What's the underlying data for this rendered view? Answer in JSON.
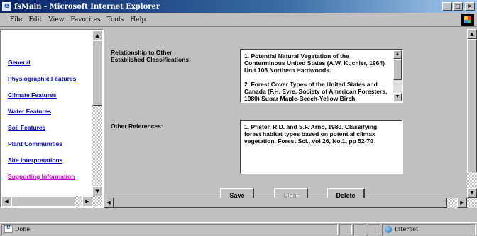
{
  "window": {
    "title": "fsMain - Microsoft Internet Explorer"
  },
  "menu": {
    "items": [
      "File",
      "Edit",
      "View",
      "Favorites",
      "Tools",
      "Help"
    ]
  },
  "nav": {
    "items": [
      {
        "label": "General"
      },
      {
        "label": "Physiographic Features"
      },
      {
        "label": "Climate Features"
      },
      {
        "label": "Water Features"
      },
      {
        "label": "Soil Features"
      },
      {
        "label": "Plant Communities"
      },
      {
        "label": "Site Interpretations"
      },
      {
        "label": "Supporting Information"
      }
    ],
    "active_color": "#cc00cc",
    "link_color": "#0000cc"
  },
  "form": {
    "relationship": {
      "label_line1": "Relationship to Other",
      "label_line2": "Established Classifications:",
      "para1": "1. Potential Natural Vegetation of the Conterminous United States (A.W. Kuchler, 1964) Unit 106 Northern Hardwoods.",
      "para2": "2. Forest Cover Types of the United States and Canada (F.H. Eyre, Society of American Foresters, 1980) Sugar Maple-Beech-Yellow Birch"
    },
    "references": {
      "label": "Other References:",
      "text": "1. Pfister, R.D. and S.F. Arno, 1980. Classifying forest habitat types based on potential climax vegetation. Forest Sci., vol 26, No.1, pp 52-70"
    },
    "buttons": {
      "save": "Save",
      "clear": "Clear",
      "delete": "Delete"
    }
  },
  "status": {
    "text": "Done",
    "zone": "Internet"
  }
}
